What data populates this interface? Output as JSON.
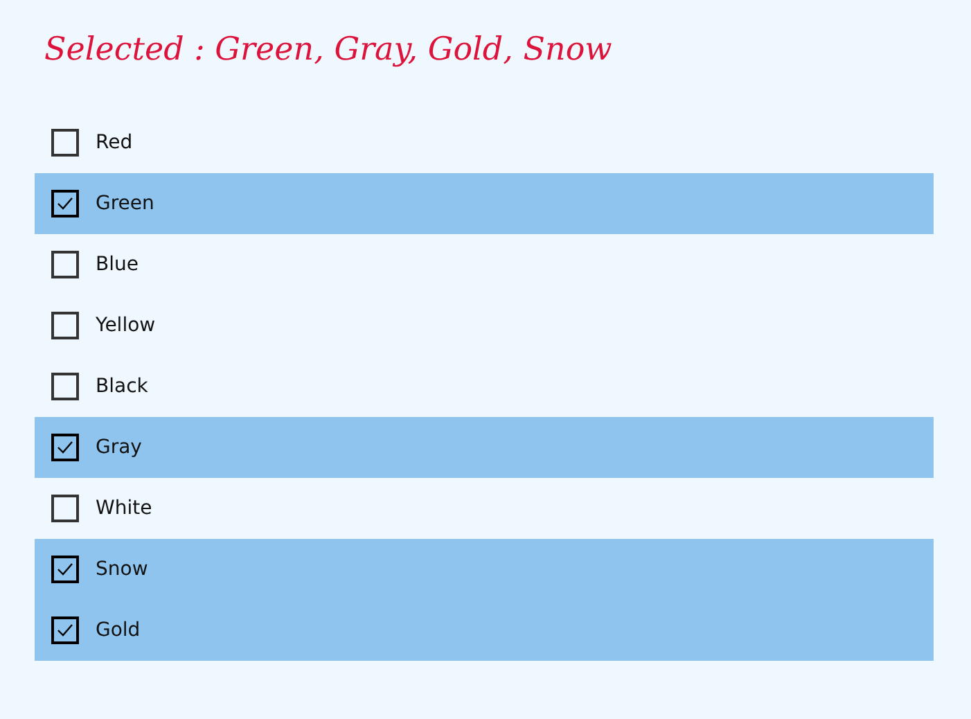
{
  "title": "Selected : Green, Gray, Gold, Snow",
  "items": [
    {
      "label": "Red",
      "checked": false
    },
    {
      "label": "Green",
      "checked": true
    },
    {
      "label": "Blue",
      "checked": false
    },
    {
      "label": "Yellow",
      "checked": false
    },
    {
      "label": "Black",
      "checked": false
    },
    {
      "label": "Gray",
      "checked": true
    },
    {
      "label": "White",
      "checked": false
    },
    {
      "label": "Snow",
      "checked": true
    },
    {
      "label": "Gold",
      "checked": true
    }
  ]
}
